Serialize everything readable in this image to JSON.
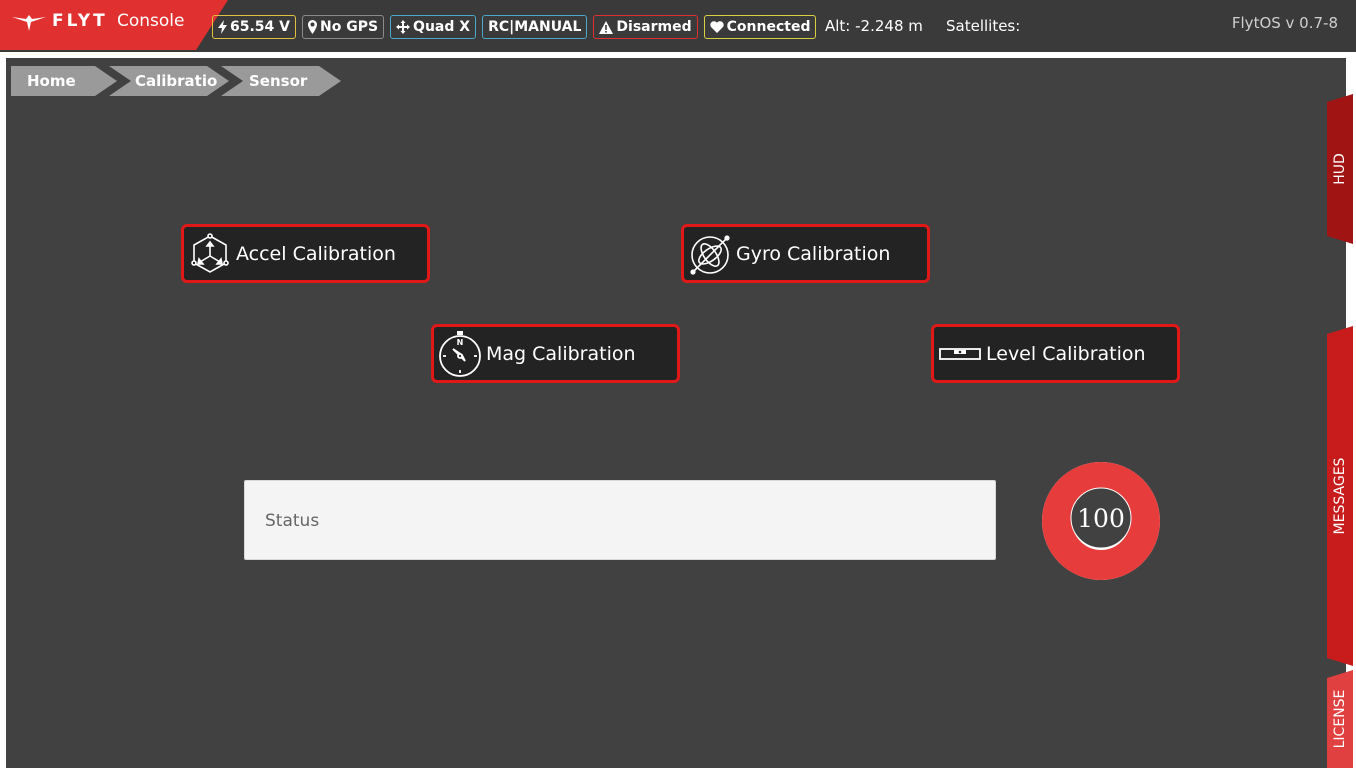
{
  "app": {
    "brand": "FLYT",
    "product": "Console",
    "version": "FlytOS v 0.7-8"
  },
  "status_bar": {
    "voltage": "65.54 V",
    "gps": "No GPS",
    "frame": "Quad X",
    "mode": "RC|MANUAL",
    "arm_state": "Disarmed",
    "link": "Connected",
    "altitude": "Alt: -2.248 m",
    "satellites": "Satellites:"
  },
  "breadcrumb": {
    "items": [
      "Home",
      "Calibratio",
      "Sensor"
    ]
  },
  "calibration": {
    "accel": "Accel Calibration",
    "gyro": "Gyro Calibration",
    "mag": "Mag Calibration",
    "level": "Level Calibration"
  },
  "status_box": {
    "text": "Status"
  },
  "progress": {
    "value": "100",
    "fraction": 1.0
  },
  "side_tabs": {
    "hud": "HUD",
    "messages": "MESSAGES",
    "license": "LICENSE"
  },
  "colors": {
    "accent": "#e01818",
    "topbar": "#3a3a3a",
    "panel": "#414141"
  },
  "icons": [
    "flyt-logo-icon",
    "bolt-icon",
    "map-pin-icon",
    "quad-icon",
    "warning-icon",
    "heart-icon",
    "accel-icon",
    "gyro-icon",
    "compass-icon",
    "level-icon"
  ]
}
